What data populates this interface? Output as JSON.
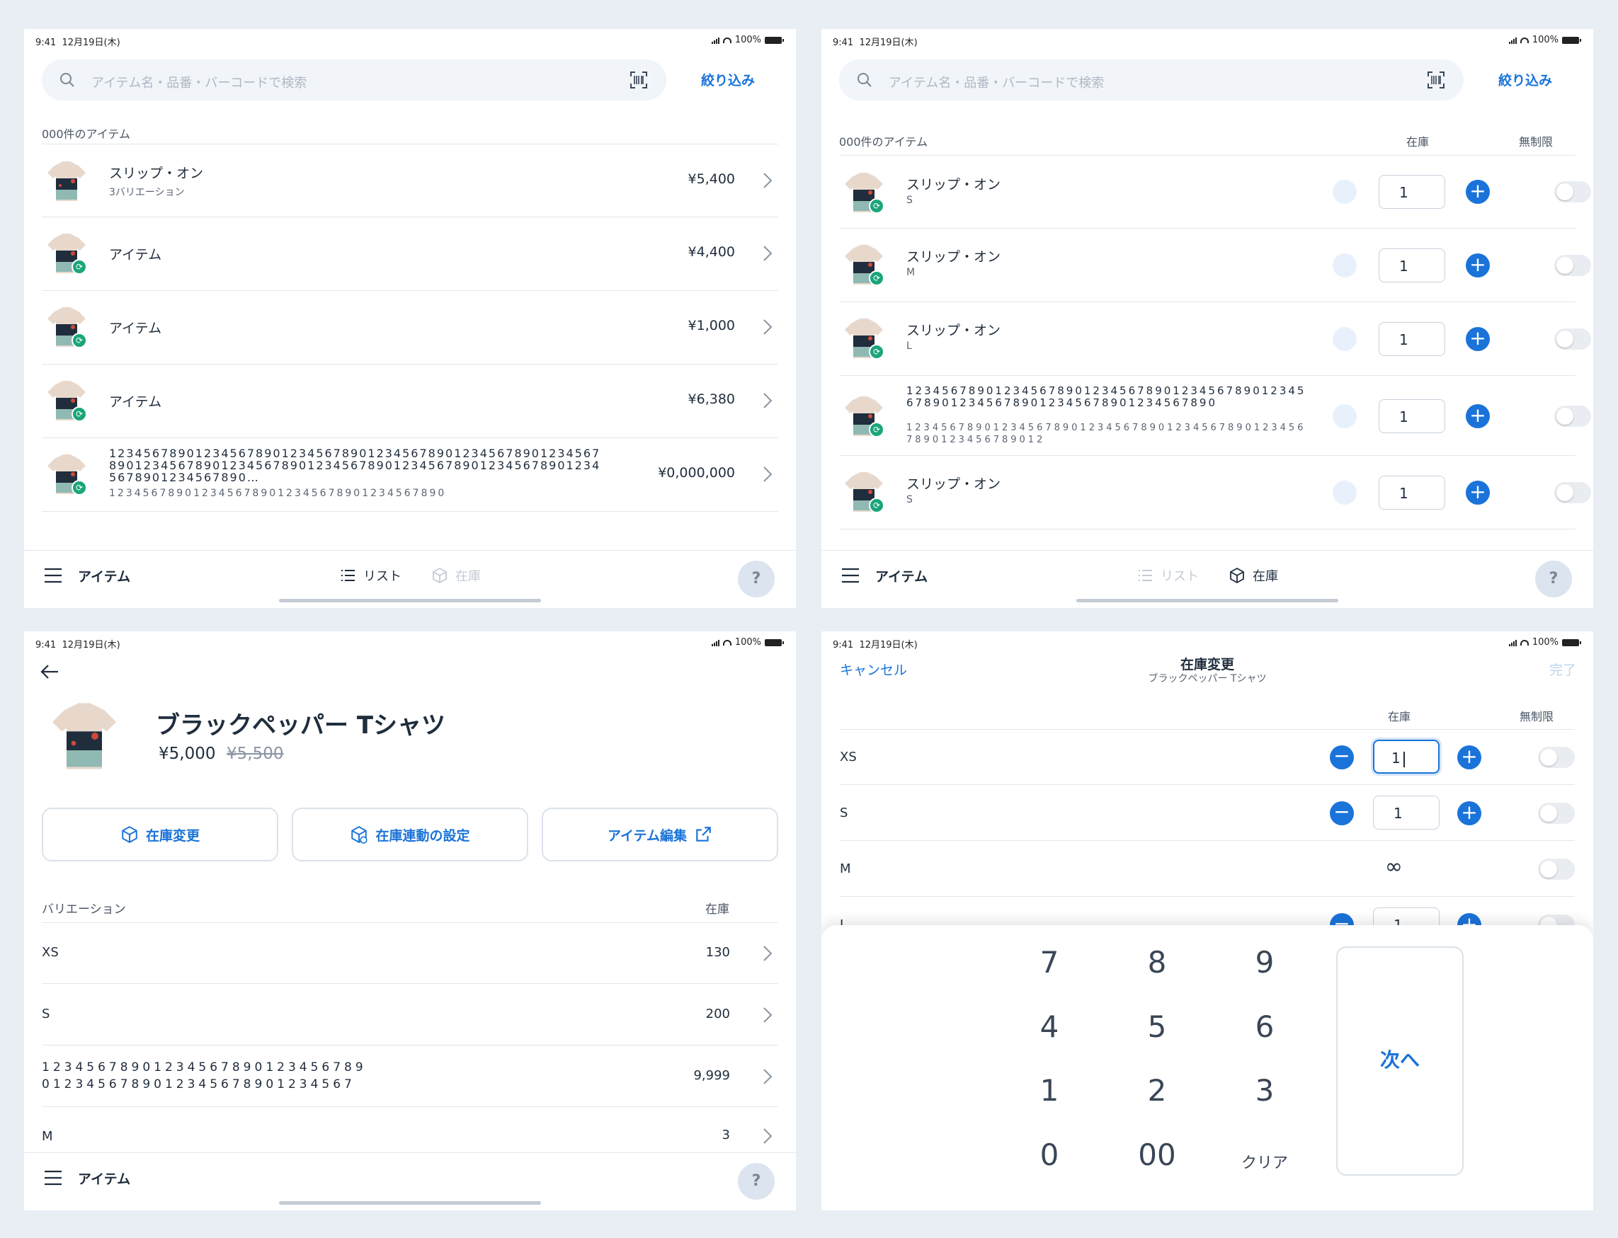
{
  "status": {
    "time": "9:41",
    "date": "12月19日(木)",
    "battery": "100%"
  },
  "search": {
    "placeholder": "アイテム名・品番・バーコードで検索",
    "filter_label": "絞り込み"
  },
  "list_view": {
    "count_label": "000件のアイテム",
    "items": [
      {
        "name": "スリップ・オン",
        "sub": "3バリエーション",
        "price": "¥5,400",
        "synced": false
      },
      {
        "name": "アイテム",
        "sub": "",
        "price": "¥4,400",
        "synced": true
      },
      {
        "name": "アイテム",
        "sub": "",
        "price": "¥1,000",
        "synced": true
      },
      {
        "name": "アイテム",
        "sub": "",
        "price": "¥6,380",
        "synced": true
      },
      {
        "name": "1234567890123456789012345678901234567890123456789012345678901234567890123456789012345678901234567890123456789012345678901234567890…",
        "sub": "1234567890123456789012345678901234567890",
        "price": "¥0,000,000",
        "synced": true
      }
    ]
  },
  "stock_view": {
    "count_label": "000件のアイテム",
    "col_stock": "在庫",
    "col_unlimited": "無制限",
    "items": [
      {
        "name": "スリップ・オン",
        "sub": "S",
        "qty": "1"
      },
      {
        "name": "スリップ・オン",
        "sub": "M",
        "qty": "1"
      },
      {
        "name": "スリップ・オン",
        "sub": "L",
        "qty": "1"
      },
      {
        "name": "12345678901234567890123456789012345678901234567890123456789012345678901234567890",
        "sub": "12345678901234567890123456789012345678901234567890123456789012",
        "qty": "1"
      },
      {
        "name": "スリップ・オン",
        "sub": "S",
        "qty": "1"
      }
    ]
  },
  "tabbar": {
    "title": "アイテム",
    "tab_list": "リスト",
    "tab_stock": "在庫",
    "help": "?"
  },
  "detail": {
    "title": "ブラックペッパー Tシャツ",
    "price": "¥5,000",
    "old_price": "¥5,500",
    "btn_stock_change": "在庫変更",
    "btn_stock_sync": "在庫連動の設定",
    "btn_edit": "アイテム編集",
    "variation_header": "バリエーション",
    "stock_header": "在庫",
    "variations": [
      {
        "label": "XS",
        "stock": "130"
      },
      {
        "label": "S",
        "stock": "200"
      },
      {
        "label": "12345678901234567890123456789\n0123456789012345678901234567",
        "stock": "9,999"
      },
      {
        "label": "M",
        "stock": "3"
      }
    ]
  },
  "stock_edit": {
    "cancel": "キャンセル",
    "title": "在庫変更",
    "subtitle": "ブラックペッパー Tシャツ",
    "done": "完了",
    "col_stock": "在庫",
    "col_unlimited": "無制限",
    "rows": [
      {
        "label": "XS",
        "qty": "1",
        "unlimited": false
      },
      {
        "label": "S",
        "qty": "1",
        "unlimited": false
      },
      {
        "label": "M",
        "qty": "∞",
        "unlimited": true
      },
      {
        "label": "L",
        "qty": "1",
        "unlimited": false
      }
    ],
    "keypad": [
      "7",
      "8",
      "9",
      "4",
      "5",
      "6",
      "1",
      "2",
      "3",
      "0",
      "00",
      "クリア"
    ],
    "next": "次へ"
  },
  "colors": {
    "accent": "#1a73d9",
    "sync_badge": "#1aa57a",
    "background": "#e9eef5"
  }
}
